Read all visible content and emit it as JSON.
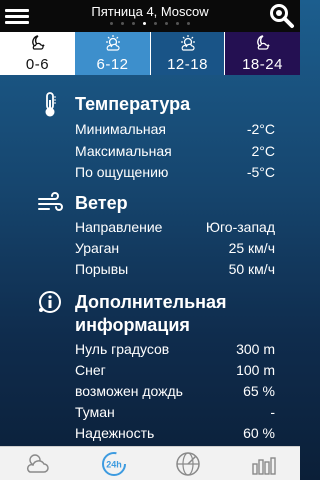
{
  "header": {
    "title": "Пятница 4, Moscow",
    "page_count": 8,
    "active_page": 3
  },
  "tabs": [
    {
      "label": "0-6",
      "icon": "moon-cloud-icon"
    },
    {
      "label": "6-12",
      "icon": "sun-cloud-icon"
    },
    {
      "label": "12-18",
      "icon": "sun-cloud-icon"
    },
    {
      "label": "18-24",
      "icon": "moon-cloud-icon"
    }
  ],
  "temperature": {
    "title": "Температура",
    "icon": "thermometer-icon",
    "rows": [
      {
        "label": "Минимальная",
        "value": "-2°C"
      },
      {
        "label": "Максимальная",
        "value": "2°C"
      },
      {
        "label": "По ощущению",
        "value": "-5°C"
      }
    ]
  },
  "wind": {
    "title": "Ветер",
    "icon": "wind-icon",
    "rows": [
      {
        "label": "Направление",
        "value": "Юго-запад"
      },
      {
        "label": "Ураган",
        "value": "25 км/ч"
      },
      {
        "label": "Порывы",
        "value": "50 км/ч"
      }
    ]
  },
  "extra": {
    "title_line1": "Дополнительная",
    "title_line2": "информация",
    "icon": "info-icon",
    "rows": [
      {
        "label": "Нуль градусов",
        "value": "300 m"
      },
      {
        "label": "Снег",
        "value": "100 m"
      },
      {
        "label": "возможен дождь",
        "value": "65 %"
      },
      {
        "label": "Туман",
        "value": "-"
      },
      {
        "label": "Надежность",
        "value": "60 %"
      }
    ]
  },
  "bottom_nav": [
    {
      "icon": "weather-cloud-sun-icon"
    },
    {
      "icon": "24h-icon"
    },
    {
      "icon": "radar-globe-icon"
    },
    {
      "icon": "bar-chart-icon"
    }
  ],
  "colors": {
    "accent": "#3d8fcc",
    "active_tab": "#195487",
    "night_tab": "#241052"
  }
}
